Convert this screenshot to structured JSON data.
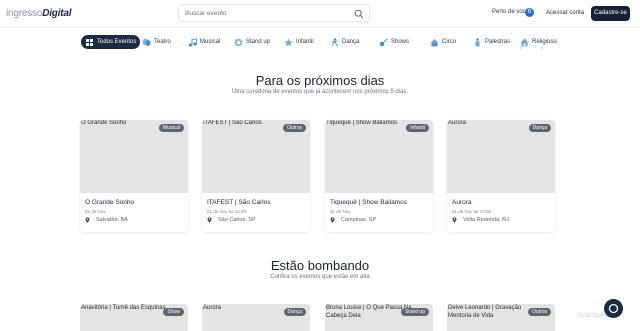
{
  "header": {
    "logo_part1": "ingresso",
    "logo_part2": "Digital",
    "search_placeholder": "Buscar evento",
    "near_label": "Perto de você",
    "near_count": "0",
    "login_label": "Acessar conta",
    "signup_label": "Cadastre-se"
  },
  "categories": [
    {
      "label": "Todos Eventos",
      "icon": "grid-icon",
      "active": true
    },
    {
      "label": "Teatro",
      "icon": "theater-masks-icon"
    },
    {
      "label": "Musical",
      "icon": "music-icon"
    },
    {
      "label": "Stand up",
      "icon": "microphone-icon"
    },
    {
      "label": "Infantil",
      "icon": "star-icon"
    },
    {
      "label": "Dança",
      "icon": "dance-icon"
    },
    {
      "label": "Shows",
      "icon": "guitar-icon"
    },
    {
      "label": "Circo",
      "icon": "circus-icon"
    },
    {
      "label": "Palestras",
      "icon": "speaker-icon"
    },
    {
      "label": "Religioso",
      "icon": "church-icon"
    }
  ],
  "carousel": {
    "prev": "‹",
    "next": "›"
  },
  "section1": {
    "title": "Para os próximos dias",
    "subtitle": "Uma curadoria de eventos que já acontecem nos próximos 5 dias.",
    "cards": [
      {
        "alt": "O Grande Sonho",
        "tag": "Musical",
        "title": "O Grande Sonho",
        "date": "01 de Nov",
        "location": "Salvador, BA"
      },
      {
        "alt": "ITAFEST | São Carlos",
        "tag": "Outros",
        "title": "ITAFEST | São Carlos",
        "date": "01 de Nov às 12:00",
        "location": "São Carlos, SP"
      },
      {
        "alt": "Tiquequê | Show Bailamos",
        "tag": "Infantil",
        "title": "Tiquequê | Show Bailamos",
        "date": "01 de Nov",
        "location": "Campinas, SP"
      },
      {
        "alt": "Aurora",
        "tag": "Dança",
        "title": "Aurora",
        "date": "01 de Nov às 17:00",
        "location": "Volta Redonda, RJ"
      }
    ]
  },
  "section2": {
    "title": "Estão bombando",
    "subtitle": "Confira os eventos que estão em alta",
    "cards": [
      {
        "alt": "Anavitória | Turnê das Esquinas",
        "tag": "Show"
      },
      {
        "alt": "Aurora",
        "tag": "Dança"
      },
      {
        "alt": "Bruna Louise | O Que Passa Na Cabeça Dela",
        "tag": "Stand up"
      },
      {
        "alt": "Deive Leonardo | Gravação Mentoria de Vida",
        "tag": "Outros"
      }
    ]
  },
  "watermark": "ScanSphere",
  "colors": {
    "primary": "#1a2b42",
    "badge": "#2e6bd8",
    "tag": "#5f6673",
    "placeholder": "#e4e4e4"
  }
}
